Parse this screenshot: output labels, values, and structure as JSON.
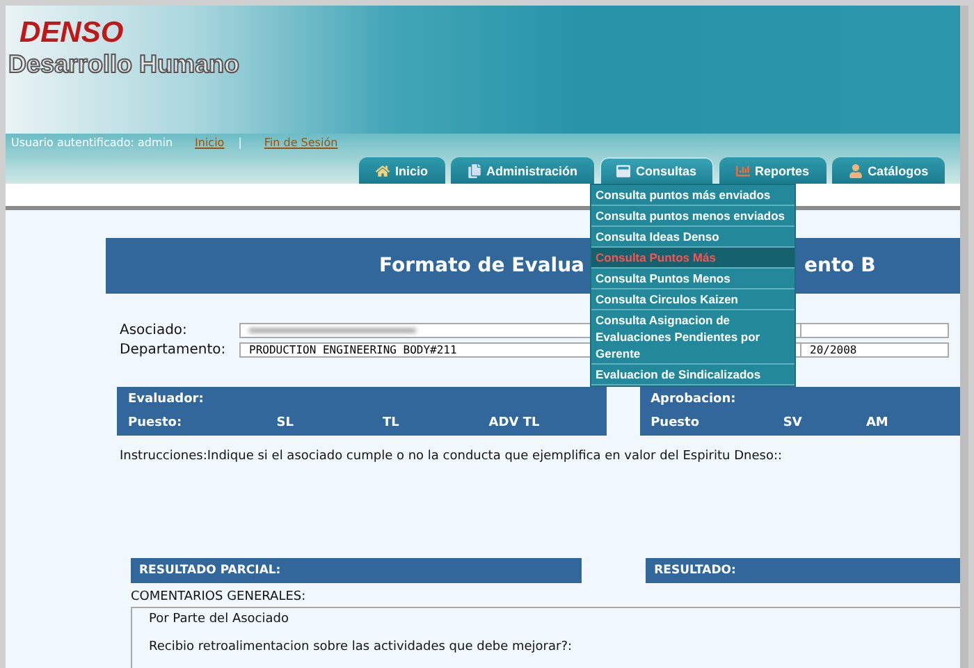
{
  "header": {
    "brand": "DENSO",
    "app_name": "Desarrollo Humano",
    "user_label": "Usuario autentificado: admin",
    "links": [
      "Inicio",
      "Fin de Sesión"
    ],
    "link_separator": "|"
  },
  "tabs": [
    {
      "label": "Inicio",
      "selected": false
    },
    {
      "label": "Administración",
      "selected": false
    },
    {
      "label": "Consultas",
      "selected": true
    },
    {
      "label": "Reportes",
      "selected": false
    },
    {
      "label": "Catálogos",
      "selected": false
    }
  ],
  "dropdown": {
    "items": [
      {
        "label": "Consulta puntos más enviados",
        "selected": false
      },
      {
        "label": "Consulta puntos menos enviados",
        "selected": false
      },
      {
        "label": "Consulta Ideas Denso",
        "selected": false
      },
      {
        "label": "Consulta Puntos Más",
        "selected": true
      },
      {
        "label": "Consulta Puntos Menos",
        "selected": false
      },
      {
        "label": "Consulta Circulos Kaizen",
        "selected": false
      },
      {
        "label": "Consulta Asignacion de Evaluaciones Pendientes por Gerente",
        "selected": false
      },
      {
        "label": "Evaluacion de Sindicalizados",
        "selected": false
      }
    ]
  },
  "form": {
    "title_left": "Formato de Evalua",
    "title_right": "ento B",
    "fields": [
      {
        "label": "Asociado:",
        "blurred": true
      },
      {
        "label": "Departamento:",
        "value": "PRODUCTION ENGINEERING BODY#211",
        "blurred": false,
        "side_value": "20/2008"
      }
    ],
    "evaluador": {
      "title": "Evaluador:",
      "columns": [
        "Puesto:",
        "SL",
        "TL",
        "ADV TL"
      ]
    },
    "aprobacion": {
      "title": "Aprobacion:",
      "columns": [
        "Puesto",
        "SV",
        "AM"
      ]
    },
    "instructions": "Instrucciones:Indique si el asociado cumple o no la conducta que ejemplifica en valor del Espiritu Dneso::",
    "result_bars": [
      "RESULTADO PARCIAL:",
      "RESULTADO:"
    ],
    "comments_label": "COMENTARIOS GENERALES:",
    "comments_box": {
      "heading": "Por Parte del Asociado",
      "question": "Recibio retroalimentacion sobre las actividades que debe mejorar?:"
    }
  }
}
